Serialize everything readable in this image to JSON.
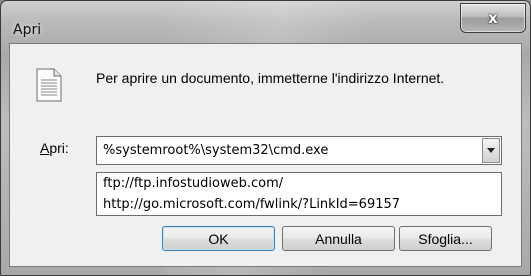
{
  "window": {
    "title": "Apri",
    "close_glyph": "x"
  },
  "dialog": {
    "message": "Per aprire un documento, immetterne l'indirizzo Internet.",
    "icon": "document-icon",
    "open_label": "Apri:",
    "combo": {
      "value": "%systemroot%\\system32\\cmd.exe",
      "options": [
        "ftp://ftp.infostudioweb.com/",
        "http://go.microsoft.com/fwlink/?LinkId=69157"
      ]
    },
    "buttons": {
      "ok": "OK",
      "cancel": "Annulla",
      "browse": "Sfoglia..."
    }
  },
  "colors": {
    "frame": "#a9a9a9",
    "client": "#f0f0f0",
    "default_button_border": "#3c7fb1"
  }
}
